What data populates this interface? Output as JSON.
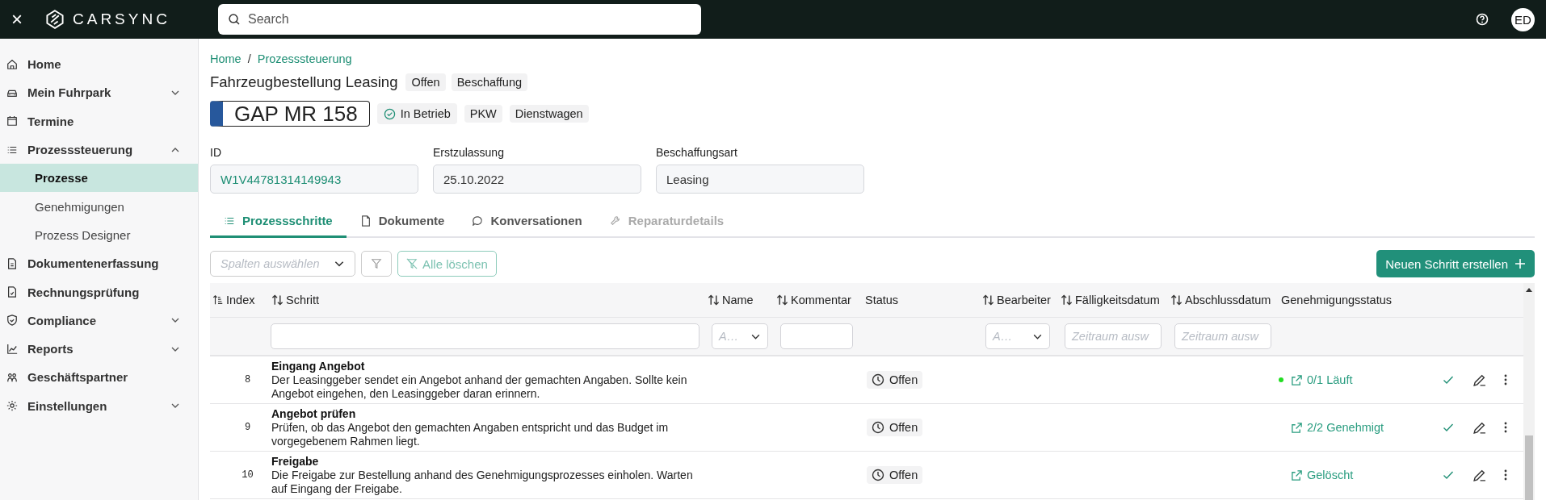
{
  "topbar": {
    "close": "×",
    "logo": "CARSYNC",
    "search": {
      "placeholder": "Search"
    },
    "avatar": "ED"
  },
  "sidebar": {
    "items": [
      {
        "label": "Home",
        "kind": "link",
        "selected": false
      },
      {
        "label": "Mein Fuhrpark",
        "kind": "group",
        "expanded": false,
        "selected": false
      },
      {
        "label": "Termine",
        "kind": "link",
        "selected": false
      },
      {
        "label": "Prozesssteuerung",
        "kind": "group",
        "expanded": true,
        "selected": false,
        "children": [
          {
            "label": "Prozesse",
            "selected": true
          },
          {
            "label": "Genehmigungen",
            "selected": false
          },
          {
            "label": "Prozess Designer",
            "selected": false
          }
        ]
      },
      {
        "label": "Dokumentenerfassung",
        "kind": "link",
        "selected": false
      },
      {
        "label": "Rechnungsprüfung",
        "kind": "link",
        "selected": false
      },
      {
        "label": "Compliance",
        "kind": "group",
        "expanded": false,
        "selected": false
      },
      {
        "label": "Reports",
        "kind": "group",
        "expanded": false,
        "selected": false
      },
      {
        "label": "Geschäftspartner",
        "kind": "link",
        "selected": false
      },
      {
        "label": "Einstellungen",
        "kind": "group",
        "expanded": false,
        "selected": false
      }
    ]
  },
  "breadcrumb": {
    "items": [
      "Home",
      "Prozesssteuerung"
    ],
    "separator": "/"
  },
  "title": "Fahrzeugbestellung Leasing",
  "title_tags": [
    "Offen",
    "Beschaffung"
  ],
  "vehicle": {
    "plate": "GAP MR 158",
    "status": "In Betrieb",
    "tags": [
      "PKW",
      "Dienstwagen"
    ]
  },
  "fields": [
    {
      "label": "ID",
      "value": "W1V44781314149943",
      "kind": "link"
    },
    {
      "label": "Erstzulassung",
      "value": "25.10.2022",
      "kind": "text"
    },
    {
      "label": "Beschaffungsart",
      "value": "Leasing",
      "kind": "text"
    }
  ],
  "tabs": [
    {
      "label": "Prozessschritte",
      "selected": true,
      "disabled": false
    },
    {
      "label": "Dokumente",
      "selected": false,
      "disabled": false
    },
    {
      "label": "Konversationen",
      "selected": false,
      "disabled": false
    },
    {
      "label": "Reparaturdetails",
      "selected": false,
      "disabled": true
    }
  ],
  "toolbar": {
    "columns_select": {
      "placeholder": "Spalten auswählen"
    },
    "clear_button": "Alle löschen",
    "create_button": "Neuen Schritt erstellen"
  },
  "table": {
    "columns": [
      {
        "label": "Index",
        "sortable": true,
        "sorted": true
      },
      {
        "label": "Schritt",
        "sortable": true,
        "sorted": false,
        "filter": {
          "kind": "text"
        }
      },
      {
        "label": "Name",
        "sortable": true,
        "sorted": false,
        "filter": {
          "kind": "select",
          "placeholder": "A…"
        }
      },
      {
        "label": "Kommentar",
        "sortable": true,
        "sorted": false,
        "filter": {
          "kind": "text"
        }
      },
      {
        "label": "Status",
        "sortable": false
      },
      {
        "label": "Bearbeiter",
        "sortable": true,
        "sorted": false,
        "filter": {
          "kind": "select",
          "placeholder": "A…"
        }
      },
      {
        "label": "Fälligkeitsdatum",
        "sortable": true,
        "sorted": false,
        "filter": {
          "kind": "date",
          "placeholder": "Zeitraum ausw"
        }
      },
      {
        "label": "Abschlussdatum",
        "sortable": true,
        "sorted": false,
        "filter": {
          "kind": "date",
          "placeholder": "Zeitraum ausw"
        }
      },
      {
        "label": "Genehmigungsstatus",
        "sortable": false
      }
    ],
    "rows": [
      {
        "index": "8",
        "title": "Eingang Angebot",
        "description": "Der Leasinggeber sendet ein Angebot anhand der gemachten Angaben. Sollte kein Angebot eingehen, den Leasinggeber daran erinnern.",
        "status": "Offen",
        "approval": "0/1 Läuft",
        "live": true
      },
      {
        "index": "9",
        "title": "Angebot prüfen",
        "description": "Prüfen, ob das Angebot den gemachten Angaben entspricht und das Budget im vorgegebenem Rahmen liegt.",
        "status": "Offen",
        "approval": "2/2 Genehmigt",
        "live": false
      },
      {
        "index": "10",
        "title": "Freigabe",
        "description": "Die Freigabe zur Bestellung anhand des Genehmigungsprozesses einholen. Warten auf Eingang der Freigabe.",
        "status": "Offen",
        "approval": "Gelöscht",
        "live": false
      }
    ]
  }
}
